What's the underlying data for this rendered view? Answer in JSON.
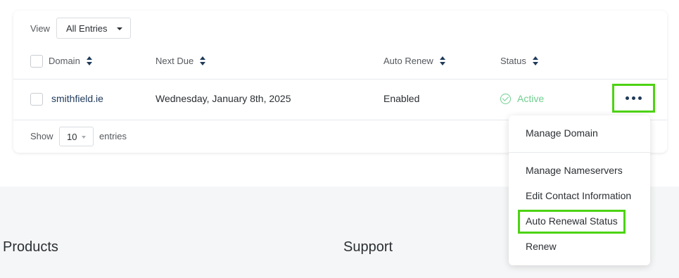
{
  "filter": {
    "view_label": "View",
    "view_selected": "All Entries"
  },
  "table": {
    "columns": [
      "Domain",
      "Next Due",
      "Auto Renew",
      "Status"
    ],
    "rows": [
      {
        "domain": "smithfield.ie",
        "next_due": "Wednesday, January 8th, 2025",
        "auto_renew": "Enabled",
        "status": "Active"
      }
    ]
  },
  "pagination": {
    "show_label": "Show",
    "page_size": "10",
    "entries_label": "entries"
  },
  "actions_menu": {
    "items": [
      "Manage Domain",
      "Manage Nameservers",
      "Edit Contact Information",
      "Auto Renewal Status",
      "Renew"
    ],
    "highlighted_item": "Auto Renewal Status"
  },
  "footer": {
    "headings": [
      "Products",
      "Support"
    ]
  },
  "colors": {
    "highlight": "#4dd312",
    "status_active": "#6fcf8f",
    "accent": "#1f3a5a",
    "footer_background": "#f5f6f7"
  }
}
